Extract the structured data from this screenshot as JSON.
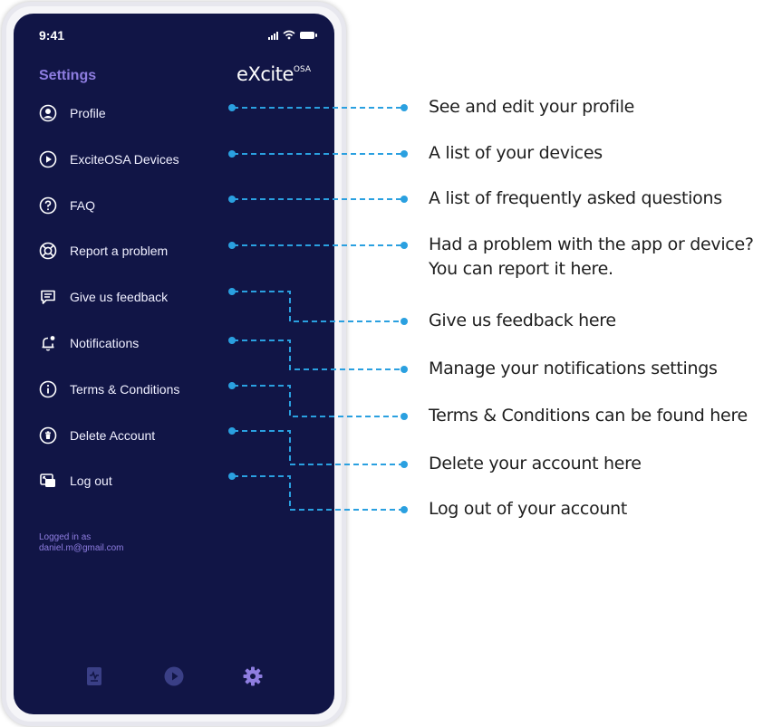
{
  "status_bar": {
    "time": "9:41"
  },
  "header": {
    "title": "Settings",
    "brand": "eXcite",
    "brand_super": "OSA"
  },
  "menu": [
    {
      "label": "Profile",
      "icon": "user-circle-icon"
    },
    {
      "label": "ExciteOSA Devices",
      "icon": "play-circle-icon"
    },
    {
      "label": "FAQ",
      "icon": "question-circle-icon"
    },
    {
      "label": "Report a problem",
      "icon": "lifebuoy-icon"
    },
    {
      "label": "Give us feedback",
      "icon": "chat-icon"
    },
    {
      "label": "Notifications",
      "icon": "bell-icon"
    },
    {
      "label": "Terms & Conditions",
      "icon": "info-circle-icon"
    },
    {
      "label": "Delete Account",
      "icon": "trash-circle-icon"
    },
    {
      "label": "Log out",
      "icon": "logout-icon"
    }
  ],
  "account": {
    "logged_in_label": "Logged in as",
    "email": "daniel.m@gmail.com"
  },
  "tab_bar": [
    "report-tab-icon",
    "play-tab-icon",
    "settings-gear-icon"
  ],
  "annotations": {
    "profile": "See and edit your profile",
    "devices": "A list of your devices",
    "faq": "A list of frequently asked questions",
    "report_line1": "Had a problem with the app or device?",
    "report_line2": "You can report it here.",
    "feedback": "Give us feedback here",
    "notifications": "Manage your notifications settings",
    "terms": "Terms & Conditions can be found here",
    "delete": "Delete your account here",
    "logout": "Log out of your account"
  },
  "colors": {
    "screen_bg": "#111546",
    "accent": "#8e7de0",
    "connector": "#2aa0e0",
    "tab_active": "#8e7de0",
    "tab_inactive": "#3a3f86"
  }
}
